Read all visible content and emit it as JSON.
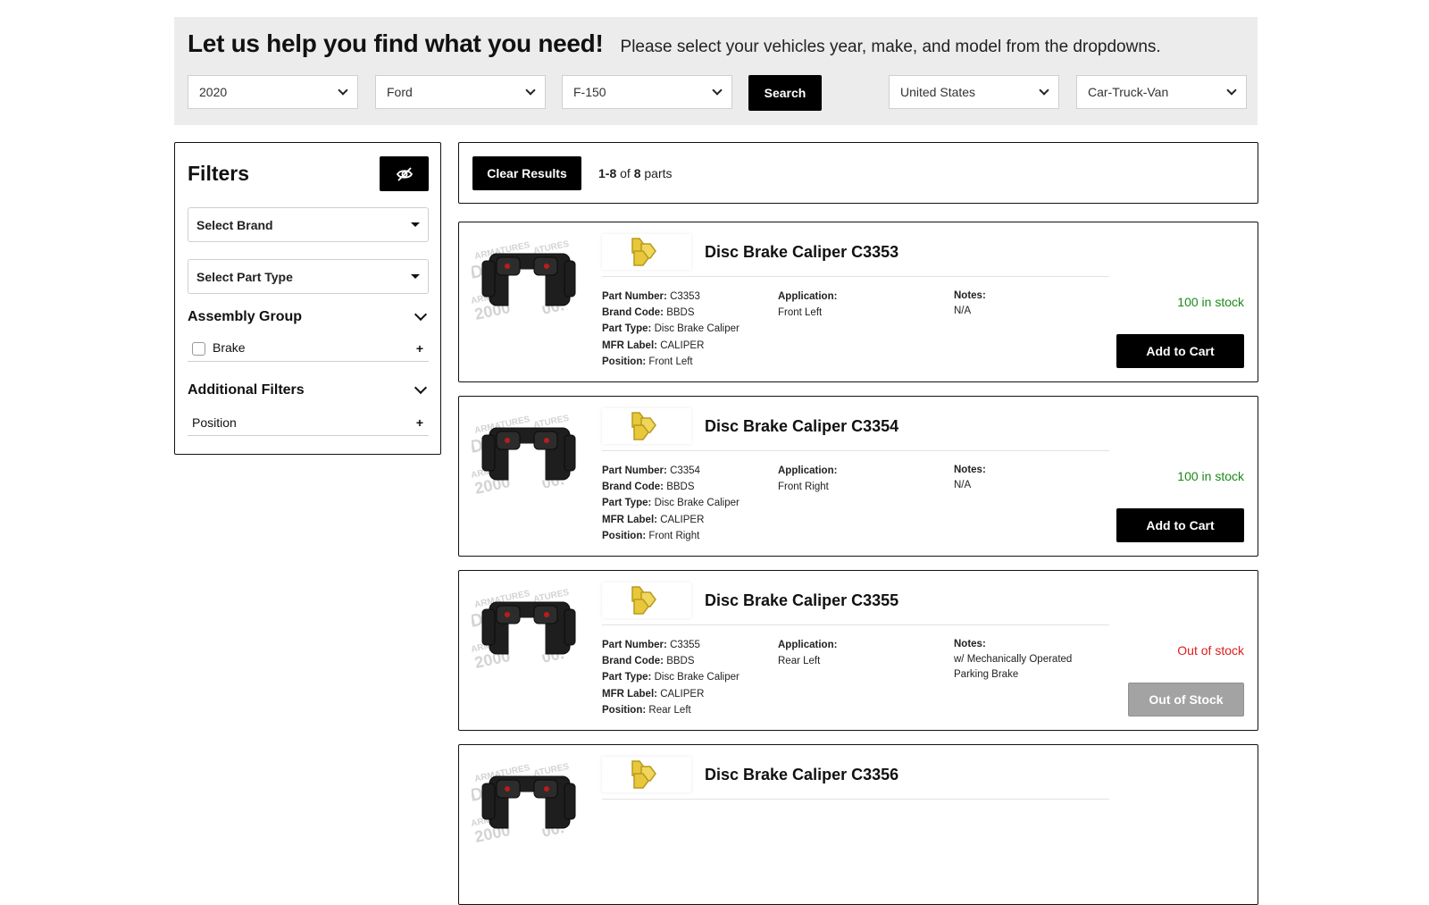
{
  "finder": {
    "headline": "Let us help you find what you need!",
    "subheadline": "Please select your vehicles year, make, and model from the dropdowns.",
    "year": "2020",
    "make": "Ford",
    "model": "F-150",
    "search_label": "Search",
    "country": "United States",
    "vehicle_type": "Car-Truck-Van"
  },
  "filters": {
    "title": "Filters",
    "brand_placeholder": "Select Brand",
    "part_type_placeholder": "Select Part Type",
    "groups": [
      {
        "title": "Assembly Group",
        "items": [
          {
            "label": "Brake"
          }
        ]
      },
      {
        "title": "Additional Filters",
        "items": [
          {
            "label": "Position"
          }
        ]
      }
    ]
  },
  "results": {
    "clear_label": "Clear Results",
    "range": "1-8",
    "of_word": "of",
    "total": "8",
    "unit": "parts"
  },
  "labels": {
    "part_number": "Part Number:",
    "brand_code": "Brand Code:",
    "part_type": "Part Type:",
    "mfr_label": "MFR Label:",
    "position": "Position:",
    "application": "Application:",
    "notes": "Notes:",
    "add_to_cart": "Add to Cart",
    "out_of_stock_button": "Out of Stock"
  },
  "colors": {
    "in_stock": "#1a8a1a",
    "out_of_stock": "#e01b1b",
    "logo_yellow": "#e8c83a"
  },
  "products": [
    {
      "title": "Disc Brake Caliper C3353",
      "part_number": "C3353",
      "brand_code": "BBDS",
      "part_type": "Disc Brake Caliper",
      "mfr_label": "CALIPER",
      "position": "Front Left",
      "application": "Front Left",
      "notes": "N/A",
      "stock": "100 in stock",
      "in_stock": true
    },
    {
      "title": "Disc Brake Caliper C3354",
      "part_number": "C3354",
      "brand_code": "BBDS",
      "part_type": "Disc Brake Caliper",
      "mfr_label": "CALIPER",
      "position": "Front Right",
      "application": "Front Right",
      "notes": "N/A",
      "stock": "100 in stock",
      "in_stock": true
    },
    {
      "title": "Disc Brake Caliper C3355",
      "part_number": "C3355",
      "brand_code": "BBDS",
      "part_type": "Disc Brake Caliper",
      "mfr_label": "CALIPER",
      "position": "Rear Left",
      "application": "Rear Left",
      "notes": "w/ Mechanically Operated Parking Brake",
      "stock": "Out of stock",
      "in_stock": false
    },
    {
      "title": "Disc Brake Caliper C3356"
    }
  ]
}
